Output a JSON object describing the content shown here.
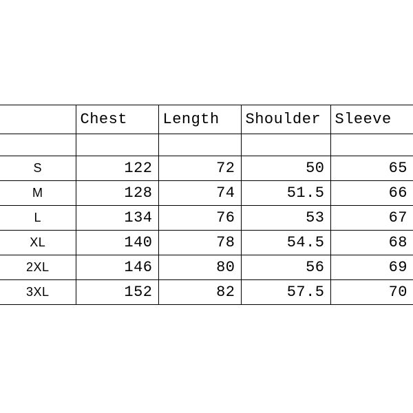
{
  "chart_data": {
    "type": "table",
    "title": "",
    "columns": [
      "",
      "Chest",
      "Length",
      "Shoulder",
      "Sleeve"
    ],
    "rows": [
      {
        "size": "S",
        "chest": 122,
        "length": 72,
        "shoulder": 50,
        "sleeve": 65
      },
      {
        "size": "M",
        "chest": 128,
        "length": 74,
        "shoulder": 51.5,
        "sleeve": 66
      },
      {
        "size": "L",
        "chest": 134,
        "length": 76,
        "shoulder": 53,
        "sleeve": 67
      },
      {
        "size": "XL",
        "chest": 140,
        "length": 78,
        "shoulder": 54.5,
        "sleeve": 68
      },
      {
        "size": "2XL",
        "chest": 146,
        "length": 80,
        "shoulder": 56,
        "sleeve": 69
      },
      {
        "size": "3XL",
        "chest": 152,
        "length": 82,
        "shoulder": 57.5,
        "sleeve": 70
      }
    ]
  }
}
